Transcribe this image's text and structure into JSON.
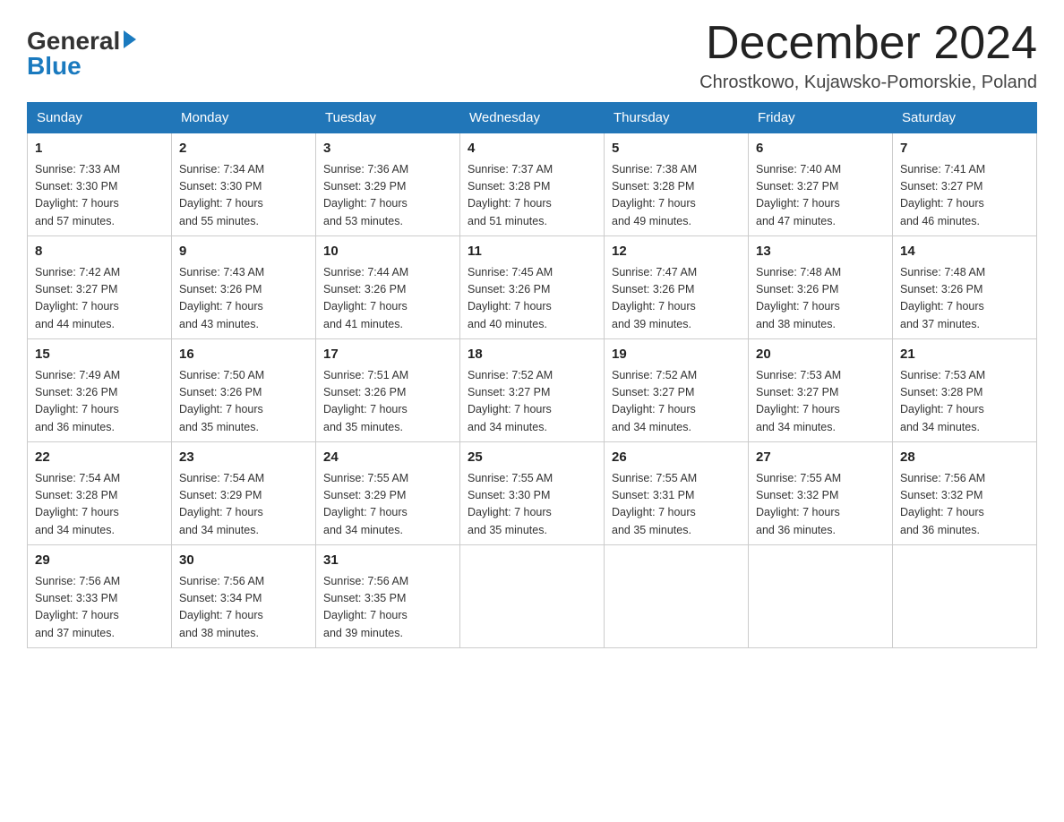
{
  "header": {
    "logo_general": "General",
    "logo_blue": "Blue",
    "month_title": "December 2024",
    "location": "Chrostkowo, Kujawsko-Pomorskie, Poland"
  },
  "days_of_week": [
    "Sunday",
    "Monday",
    "Tuesday",
    "Wednesday",
    "Thursday",
    "Friday",
    "Saturday"
  ],
  "weeks": [
    [
      {
        "day": "1",
        "sunrise": "7:33 AM",
        "sunset": "3:30 PM",
        "daylight": "7 hours and 57 minutes."
      },
      {
        "day": "2",
        "sunrise": "7:34 AM",
        "sunset": "3:30 PM",
        "daylight": "7 hours and 55 minutes."
      },
      {
        "day": "3",
        "sunrise": "7:36 AM",
        "sunset": "3:29 PM",
        "daylight": "7 hours and 53 minutes."
      },
      {
        "day": "4",
        "sunrise": "7:37 AM",
        "sunset": "3:28 PM",
        "daylight": "7 hours and 51 minutes."
      },
      {
        "day": "5",
        "sunrise": "7:38 AM",
        "sunset": "3:28 PM",
        "daylight": "7 hours and 49 minutes."
      },
      {
        "day": "6",
        "sunrise": "7:40 AM",
        "sunset": "3:27 PM",
        "daylight": "7 hours and 47 minutes."
      },
      {
        "day": "7",
        "sunrise": "7:41 AM",
        "sunset": "3:27 PM",
        "daylight": "7 hours and 46 minutes."
      }
    ],
    [
      {
        "day": "8",
        "sunrise": "7:42 AM",
        "sunset": "3:27 PM",
        "daylight": "7 hours and 44 minutes."
      },
      {
        "day": "9",
        "sunrise": "7:43 AM",
        "sunset": "3:26 PM",
        "daylight": "7 hours and 43 minutes."
      },
      {
        "day": "10",
        "sunrise": "7:44 AM",
        "sunset": "3:26 PM",
        "daylight": "7 hours and 41 minutes."
      },
      {
        "day": "11",
        "sunrise": "7:45 AM",
        "sunset": "3:26 PM",
        "daylight": "7 hours and 40 minutes."
      },
      {
        "day": "12",
        "sunrise": "7:47 AM",
        "sunset": "3:26 PM",
        "daylight": "7 hours and 39 minutes."
      },
      {
        "day": "13",
        "sunrise": "7:48 AM",
        "sunset": "3:26 PM",
        "daylight": "7 hours and 38 minutes."
      },
      {
        "day": "14",
        "sunrise": "7:48 AM",
        "sunset": "3:26 PM",
        "daylight": "7 hours and 37 minutes."
      }
    ],
    [
      {
        "day": "15",
        "sunrise": "7:49 AM",
        "sunset": "3:26 PM",
        "daylight": "7 hours and 36 minutes."
      },
      {
        "day": "16",
        "sunrise": "7:50 AM",
        "sunset": "3:26 PM",
        "daylight": "7 hours and 35 minutes."
      },
      {
        "day": "17",
        "sunrise": "7:51 AM",
        "sunset": "3:26 PM",
        "daylight": "7 hours and 35 minutes."
      },
      {
        "day": "18",
        "sunrise": "7:52 AM",
        "sunset": "3:27 PM",
        "daylight": "7 hours and 34 minutes."
      },
      {
        "day": "19",
        "sunrise": "7:52 AM",
        "sunset": "3:27 PM",
        "daylight": "7 hours and 34 minutes."
      },
      {
        "day": "20",
        "sunrise": "7:53 AM",
        "sunset": "3:27 PM",
        "daylight": "7 hours and 34 minutes."
      },
      {
        "day": "21",
        "sunrise": "7:53 AM",
        "sunset": "3:28 PM",
        "daylight": "7 hours and 34 minutes."
      }
    ],
    [
      {
        "day": "22",
        "sunrise": "7:54 AM",
        "sunset": "3:28 PM",
        "daylight": "7 hours and 34 minutes."
      },
      {
        "day": "23",
        "sunrise": "7:54 AM",
        "sunset": "3:29 PM",
        "daylight": "7 hours and 34 minutes."
      },
      {
        "day": "24",
        "sunrise": "7:55 AM",
        "sunset": "3:29 PM",
        "daylight": "7 hours and 34 minutes."
      },
      {
        "day": "25",
        "sunrise": "7:55 AM",
        "sunset": "3:30 PM",
        "daylight": "7 hours and 35 minutes."
      },
      {
        "day": "26",
        "sunrise": "7:55 AM",
        "sunset": "3:31 PM",
        "daylight": "7 hours and 35 minutes."
      },
      {
        "day": "27",
        "sunrise": "7:55 AM",
        "sunset": "3:32 PM",
        "daylight": "7 hours and 36 minutes."
      },
      {
        "day": "28",
        "sunrise": "7:56 AM",
        "sunset": "3:32 PM",
        "daylight": "7 hours and 36 minutes."
      }
    ],
    [
      {
        "day": "29",
        "sunrise": "7:56 AM",
        "sunset": "3:33 PM",
        "daylight": "7 hours and 37 minutes."
      },
      {
        "day": "30",
        "sunrise": "7:56 AM",
        "sunset": "3:34 PM",
        "daylight": "7 hours and 38 minutes."
      },
      {
        "day": "31",
        "sunrise": "7:56 AM",
        "sunset": "3:35 PM",
        "daylight": "7 hours and 39 minutes."
      },
      null,
      null,
      null,
      null
    ]
  ],
  "labels": {
    "sunrise_prefix": "Sunrise: ",
    "sunset_prefix": "Sunset: ",
    "daylight_prefix": "Daylight: "
  }
}
